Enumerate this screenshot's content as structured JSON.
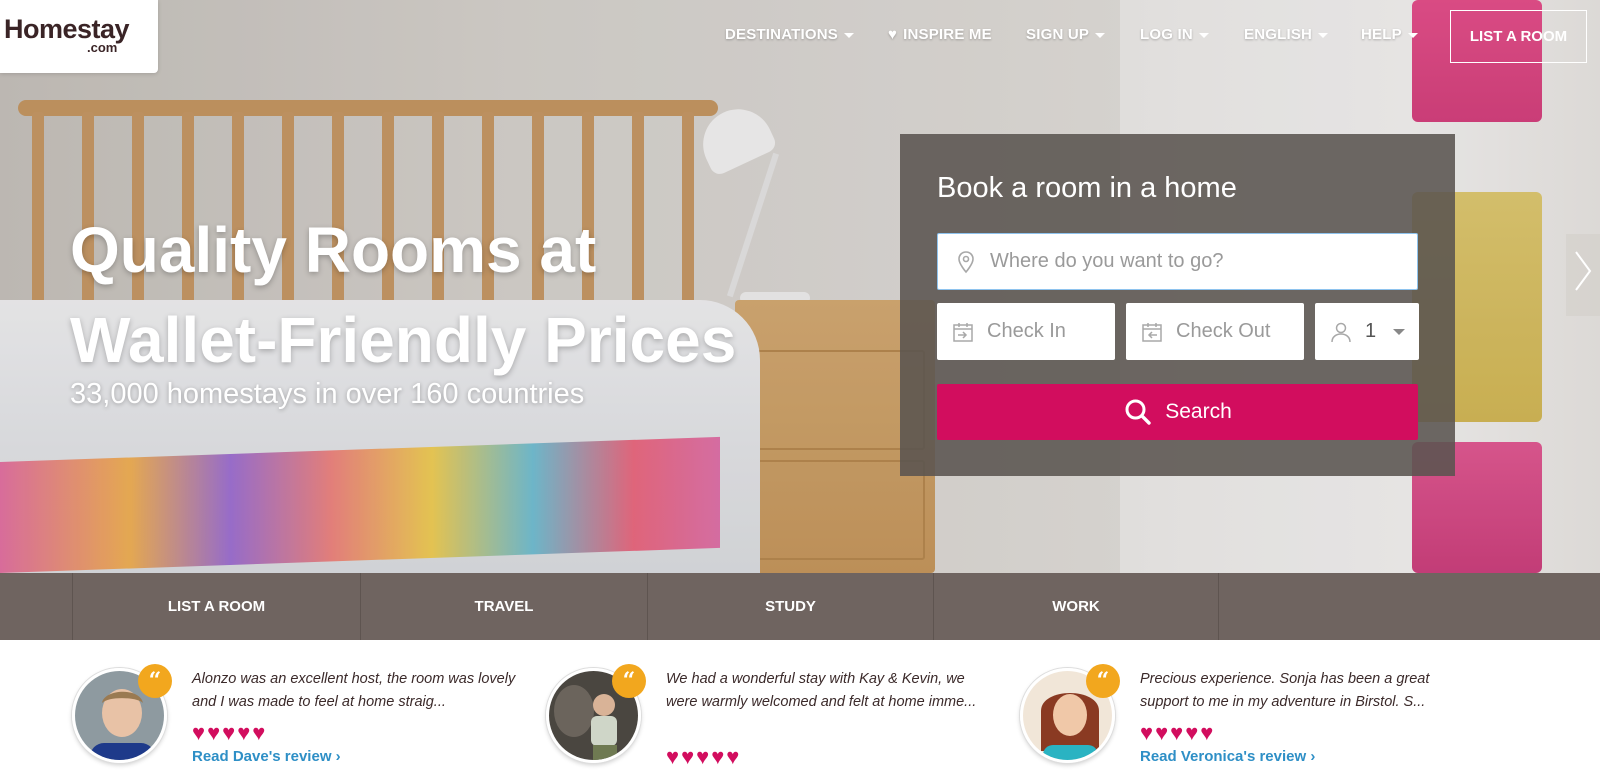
{
  "logo": {
    "brand": "Homestay",
    "sub": ".com"
  },
  "nav": {
    "destinations": "DESTINATIONS",
    "inspire": "INSPIRE ME",
    "signup": "SIGN UP",
    "login": "LOG IN",
    "language": "ENGLISH",
    "help": "HELP",
    "list_room": "LIST A ROOM"
  },
  "hero": {
    "headline_line1": "Quality Rooms at",
    "headline_line2": "Wallet-Friendly Prices",
    "subline": "33,000 homestays in over 160 countries"
  },
  "booking": {
    "title": "Book a room in a home",
    "where_placeholder": "Where do you want to go?",
    "checkin_placeholder": "Check In",
    "checkout_placeholder": "Check Out",
    "guests_value": "1",
    "search_label": "Search"
  },
  "band": {
    "tabs": [
      {
        "label": "LIST A ROOM"
      },
      {
        "label": "TRAVEL"
      },
      {
        "label": "STUDY"
      },
      {
        "label": "WORK"
      }
    ]
  },
  "reviews": [
    {
      "text": "Alonzo was an excellent host, the room was lovely and I was made to feel at home straig...",
      "rating": 5,
      "link": "Read Dave's review  ›"
    },
    {
      "text": "We had a wonderful stay with Kay & Kevin, we were warmly welcomed and felt at home imme...",
      "rating": 5,
      "link": ""
    },
    {
      "text": "Precious experience. Sonja has been a great support to me in my adventure in Birstol. S...",
      "rating": 5,
      "link": "Read Veronica's review  ›"
    }
  ],
  "colors": {
    "accent": "#d20d5e",
    "band": "#6f6460",
    "link": "#2e8fc6",
    "quote_badge": "#f2a71e"
  }
}
